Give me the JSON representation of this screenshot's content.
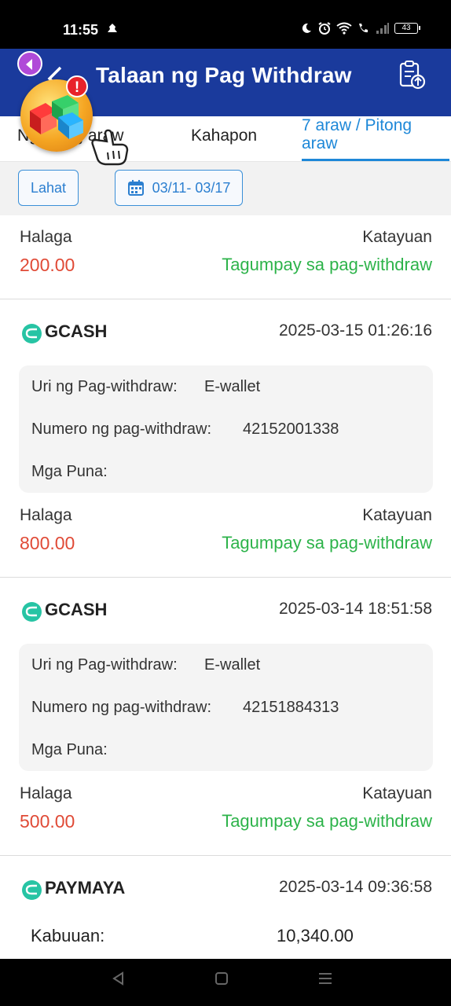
{
  "status_bar": {
    "time": "11:55",
    "battery": "43",
    "icons": [
      "moon-icon",
      "alarm-icon",
      "wifi-icon",
      "call-icon",
      "signal-icon",
      "battery-icon"
    ]
  },
  "header": {
    "title": "Talaan ng Pag Withdraw",
    "accent_color": "#1a3a9c"
  },
  "tabs": [
    {
      "label": "Ngayong araw"
    },
    {
      "label": "Kahapon"
    },
    {
      "label": "7 araw / Pitong araw",
      "active": true
    }
  ],
  "tab_today_visible": "N",
  "tab_today_tail": "g",
  "tab_today_end": "aw",
  "filter": {
    "all_label": "Lahat",
    "date_range": "03/11- 03/17"
  },
  "records_top": {
    "amount_label": "Halaga",
    "status_label": "Katayuan",
    "amount": "200.00",
    "status": "Tagumpay sa pag-withdraw"
  },
  "records": [
    {
      "method": "GCASH",
      "datetime": "2025-03-15 01:26:16",
      "type_label": "Uri ng Pag-withdraw:",
      "type_value": "E-wallet",
      "number_label": "Numero ng pag-withdraw:",
      "number_value": "42152001338",
      "remarks_label": "Mga Puna:",
      "amount_label": "Halaga",
      "status_label": "Katayuan",
      "amount": "800.00",
      "status": "Tagumpay sa pag-withdraw"
    },
    {
      "method": "GCASH",
      "datetime": "2025-03-14 18:51:58",
      "type_label": "Uri ng Pag-withdraw:",
      "type_value": "E-wallet",
      "number_label": "Numero ng pag-withdraw:",
      "number_value": "42151884313",
      "remarks_label": "Mga Puna:",
      "amount_label": "Halaga",
      "status_label": "Katayuan",
      "amount": "500.00",
      "status": "Tagumpay sa pag-withdraw"
    },
    {
      "method": "PAYMAYA",
      "datetime": "2025-03-14 09:36:58"
    }
  ],
  "total": {
    "label": "Kabuuan:",
    "value": "10,340.00"
  },
  "floating_badge": "!",
  "colors": {
    "amount": "#e04a36",
    "success": "#2db34a",
    "link": "#1e88d8"
  }
}
